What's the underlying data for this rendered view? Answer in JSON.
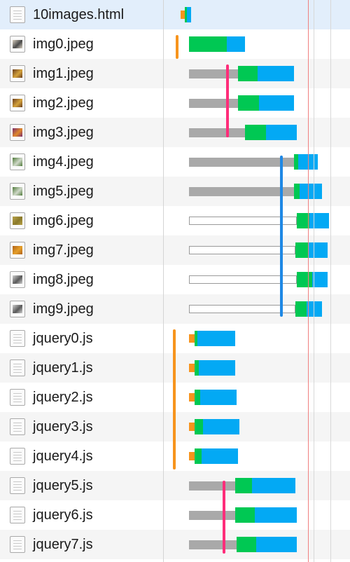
{
  "colors": {
    "row_alt": "#f5f5f5",
    "row_selected": "#e2eefb",
    "queued": "#a9a9a9",
    "dns": "#f7941d",
    "connect": "#00c853",
    "download": "#03a9f4",
    "gridline": "#d8d8d8",
    "load_line": "#f08080",
    "marker_orange": "#f7941d",
    "marker_pink": "#ff2d7a",
    "marker_blue": "#1e88e5"
  },
  "requests": [
    {
      "name": "10images.html",
      "icon": "document-icon"
    },
    {
      "name": "img0.jpeg",
      "icon": "image-icon"
    },
    {
      "name": "img1.jpeg",
      "icon": "image-icon"
    },
    {
      "name": "img2.jpeg",
      "icon": "image-icon"
    },
    {
      "name": "img3.jpeg",
      "icon": "image-icon"
    },
    {
      "name": "img4.jpeg",
      "icon": "image-icon"
    },
    {
      "name": "img5.jpeg",
      "icon": "image-icon"
    },
    {
      "name": "img6.jpeg",
      "icon": "image-icon"
    },
    {
      "name": "img7.jpeg",
      "icon": "image-icon"
    },
    {
      "name": "img8.jpeg",
      "icon": "image-icon"
    },
    {
      "name": "img9.jpeg",
      "icon": "image-icon"
    },
    {
      "name": "jquery0.js",
      "icon": "document-icon"
    },
    {
      "name": "jquery1.js",
      "icon": "document-icon"
    },
    {
      "name": "jquery2.js",
      "icon": "document-icon"
    },
    {
      "name": "jquery3.js",
      "icon": "document-icon"
    },
    {
      "name": "jquery4.js",
      "icon": "document-icon"
    },
    {
      "name": "jquery5.js",
      "icon": "document-icon"
    },
    {
      "name": "jquery6.js",
      "icon": "document-icon"
    },
    {
      "name": "jquery7.js",
      "icon": "document-icon"
    }
  ]
}
